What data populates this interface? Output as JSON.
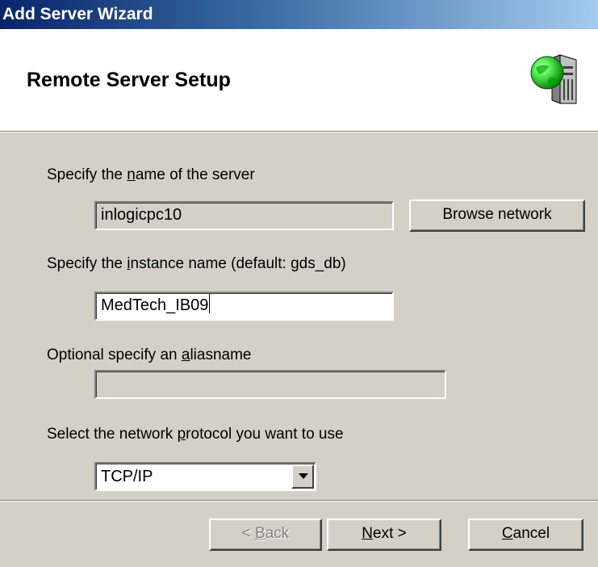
{
  "window": {
    "title": "Add Server Wizard"
  },
  "header": {
    "title": "Remote Server Setup",
    "icon": "server-icon"
  },
  "server_name": {
    "label_pre": "Specify the ",
    "label_acc": "n",
    "label_post": "ame of the server",
    "value": "inlogicpc10",
    "browse_label": "Browse network"
  },
  "instance": {
    "label_pre": "Specify the ",
    "label_acc": "i",
    "label_post": "nstance name (default: gds_db)",
    "value": "MedTech_IB09"
  },
  "alias": {
    "label_pre": "Optional specify an ",
    "label_acc": "a",
    "label_post": "liasname",
    "value": ""
  },
  "protocol": {
    "label_pre": "Select the network ",
    "label_acc": "p",
    "label_post": "rotocol you want to use",
    "selected": "TCP/IP"
  },
  "footer": {
    "back_pre": "< ",
    "back_acc": "B",
    "back_post": "ack",
    "next_acc": "N",
    "next_post": "ext >",
    "cancel_acc": "C",
    "cancel_post": "ancel"
  }
}
